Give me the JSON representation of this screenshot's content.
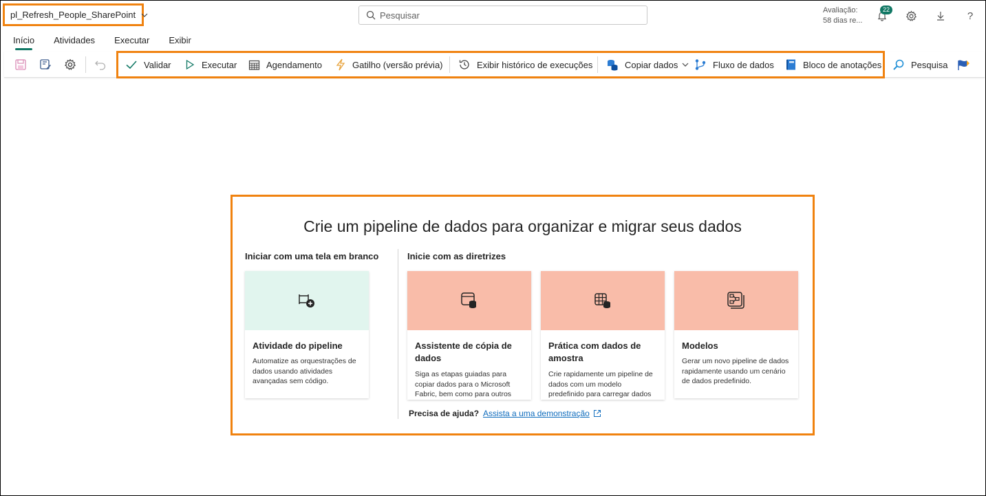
{
  "header": {
    "pipeline_name": "pl_Refresh_People_SharePoint",
    "search_placeholder": "Pesquisar",
    "trial_line1": "Avaliação:",
    "trial_line2": "58 dias re...",
    "notification_count": "22",
    "help_glyph": "?"
  },
  "tabs": [
    {
      "label": "Início",
      "active": true
    },
    {
      "label": "Atividades",
      "active": false
    },
    {
      "label": "Executar",
      "active": false
    },
    {
      "label": "Exibir",
      "active": false
    }
  ],
  "ribbon": {
    "validate": "Validar",
    "run": "Executar",
    "schedule": "Agendamento",
    "trigger": "Gatilho (versão prévia)",
    "history": "Exibir histórico de execuções",
    "copy_data": "Copiar dados",
    "dataflow": "Fluxo de dados",
    "notebook": "Bloco de anotações",
    "search": "Pesquisa"
  },
  "panel": {
    "title": "Crie um pipeline de dados para organizar e migrar seus dados",
    "blank_heading": "Iniciar com uma tela em branco",
    "guided_heading": "Inicie com as diretrizes",
    "cards": [
      {
        "title": "Atividade do pipeline",
        "desc": "Automatize as orquestrações de dados usando atividades avançadas sem código."
      },
      {
        "title": "Assistente de cópia de dados",
        "desc": "Siga as etapas guiadas para copiar dados para o Microsoft Fabric, bem como para outros armazenamentos de dados."
      },
      {
        "title": "Prática com dados de amostra",
        "desc": "Crie rapidamente um pipeline de dados com um modelo predefinido para carregar dados no Lakehouse."
      },
      {
        "title": "Modelos",
        "desc": "Gerar um novo pipeline de dados rapidamente usando um cenário de dados predefinido."
      }
    ],
    "help_question": "Precisa de ajuda?",
    "help_link": "Assista a uma demonstração"
  },
  "colors": {
    "highlight": "#f0820f",
    "accent": "#117865",
    "card_blank_bg": "#e1f5ee",
    "card_guided_bg": "#f9bca9",
    "link": "#0f6cbd"
  }
}
